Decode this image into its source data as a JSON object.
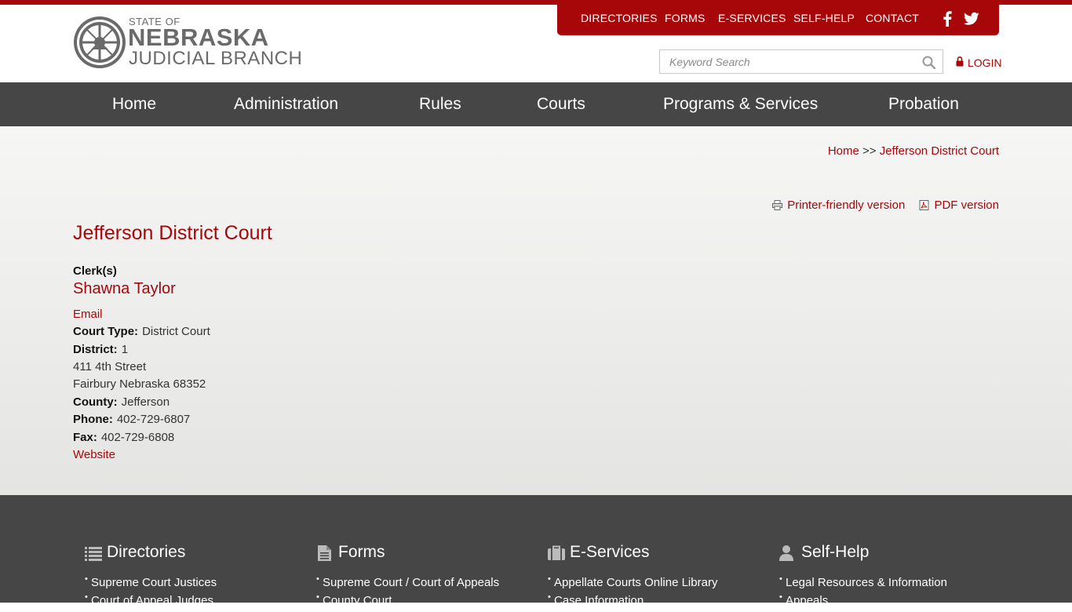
{
  "header": {
    "logo": {
      "line1": "STATE OF",
      "line2": "NEBRASKA",
      "line3": "JUDICIAL BRANCH"
    },
    "utility_nav": [
      "DIRECTORIES",
      "FORMS",
      "E-SERVICES",
      "SELF-HELP",
      "CONTACT"
    ],
    "search": {
      "placeholder": "Keyword Search",
      "value": ""
    },
    "login_label": "LOGIN"
  },
  "main_nav": [
    "Home",
    "Administration",
    "Rules",
    "Courts",
    "Programs & Services",
    "Probation"
  ],
  "breadcrumb": {
    "home": "Home",
    "separator": ">>",
    "current": "Jefferson District Court"
  },
  "page_tools": {
    "printer": "Printer-friendly version",
    "pdf": "PDF version"
  },
  "court": {
    "title": "Jefferson District Court",
    "clerks_label": "Clerk(s)",
    "clerk_name": "Shawna Taylor",
    "email_label": "Email",
    "court_type_label": "Court Type:",
    "court_type": "District Court",
    "district_label": "District:",
    "district": "1",
    "address_line1": "411 4th Street",
    "address_line2": "Fairbury Nebraska 68352",
    "county_label": "County:",
    "county": "Jefferson",
    "phone_label": "Phone:",
    "phone": "402-729-6807",
    "fax_label": "Fax:",
    "fax": "402-729-6808",
    "website_label": "Website"
  },
  "footer": {
    "columns": [
      {
        "title": "Directories",
        "icon": "list-icon",
        "items": [
          "Supreme Court Justices",
          "Court of Appeal Judges"
        ]
      },
      {
        "title": "Forms",
        "icon": "document-icon",
        "items": [
          "Supreme Court / Court of Appeals",
          "County Court"
        ]
      },
      {
        "title": "E-Services",
        "icon": "briefcase-icon",
        "items": [
          "Appellate Courts Online Library",
          "Case Information"
        ]
      },
      {
        "title": "Self-Help",
        "icon": "person-icon",
        "items": [
          "Legal Resources & Information",
          "Appeals"
        ]
      }
    ]
  },
  "colors": {
    "brand_red": "#a8070a",
    "nav_gray": "#464646",
    "logo_gray": "#6a6a6a"
  }
}
